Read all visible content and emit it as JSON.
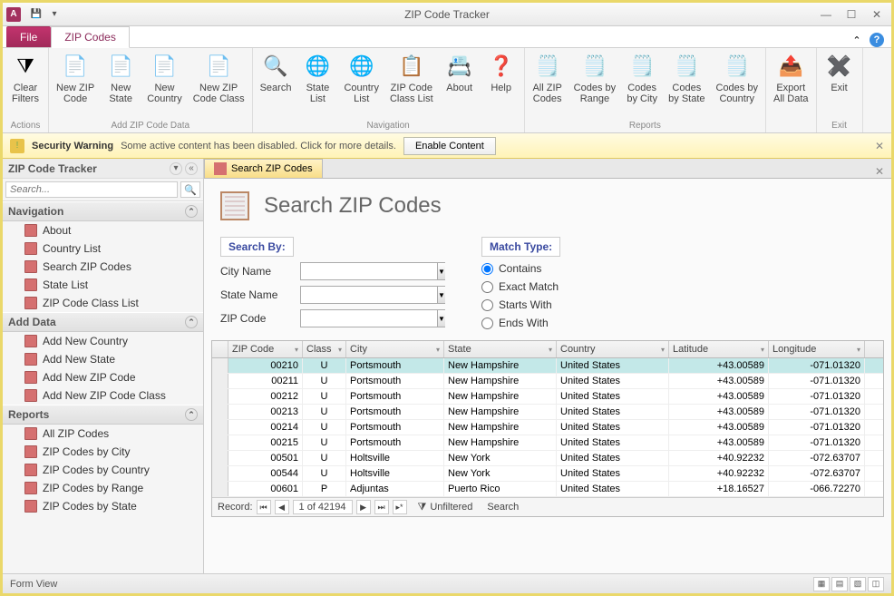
{
  "window": {
    "title": "ZIP Code Tracker"
  },
  "ribbon": {
    "file_tab": "File",
    "active_tab": "ZIP Codes",
    "groups": {
      "actions": {
        "label": "Actions",
        "clear_filters": "Clear\nFilters"
      },
      "add": {
        "label": "Add ZIP Code Data",
        "new_zip": "New ZIP\nCode",
        "new_state": "New\nState",
        "new_country": "New\nCountry",
        "new_class": "New ZIP\nCode Class"
      },
      "nav": {
        "label": "Navigation",
        "search": "Search",
        "state_list": "State\nList",
        "country_list": "Country\nList",
        "class_list": "ZIP Code\nClass List",
        "about": "About",
        "help": "Help"
      },
      "reports": {
        "label": "Reports",
        "all": "All ZIP\nCodes",
        "by_range": "Codes by\nRange",
        "by_city": "Codes\nby City",
        "by_state": "Codes\nby State",
        "by_country": "Codes by\nCountry"
      },
      "export": {
        "label": "",
        "export_all": "Export\nAll Data"
      },
      "exit": {
        "label": "Exit",
        "exit": "Exit"
      }
    }
  },
  "security": {
    "title": "Security Warning",
    "msg": "Some active content has been disabled. Click for more details.",
    "enable": "Enable Content"
  },
  "navpane": {
    "title": "ZIP Code Tracker",
    "search_placeholder": "Search...",
    "groups": [
      {
        "label": "Navigation",
        "items": [
          "About",
          "Country List",
          "Search ZIP Codes",
          "State List",
          "ZIP Code Class List"
        ]
      },
      {
        "label": "Add Data",
        "items": [
          "Add New Country",
          "Add New State",
          "Add New ZIP Code",
          "Add New ZIP Code Class"
        ]
      },
      {
        "label": "Reports",
        "items": [
          "All ZIP Codes",
          "ZIP Codes by City",
          "ZIP Codes by Country",
          "ZIP Codes by Range",
          "ZIP Codes by State"
        ]
      }
    ]
  },
  "doctab": {
    "label": "Search ZIP Codes"
  },
  "form": {
    "title": "Search ZIP Codes",
    "search_by": "Search By:",
    "city_name": "City Name",
    "state_name": "State Name",
    "zip_code": "ZIP Code",
    "match_type": "Match Type:",
    "contains": "Contains",
    "exact": "Exact Match",
    "starts": "Starts With",
    "ends": "Ends With"
  },
  "grid": {
    "columns": [
      "ZIP Code",
      "Class",
      "City",
      "State",
      "Country",
      "Latitude",
      "Longitude"
    ],
    "rows": [
      [
        "00210",
        "U",
        "Portsmouth",
        "New Hampshire",
        "United States",
        "+43.00589",
        "-071.01320"
      ],
      [
        "00211",
        "U",
        "Portsmouth",
        "New Hampshire",
        "United States",
        "+43.00589",
        "-071.01320"
      ],
      [
        "00212",
        "U",
        "Portsmouth",
        "New Hampshire",
        "United States",
        "+43.00589",
        "-071.01320"
      ],
      [
        "00213",
        "U",
        "Portsmouth",
        "New Hampshire",
        "United States",
        "+43.00589",
        "-071.01320"
      ],
      [
        "00214",
        "U",
        "Portsmouth",
        "New Hampshire",
        "United States",
        "+43.00589",
        "-071.01320"
      ],
      [
        "00215",
        "U",
        "Portsmouth",
        "New Hampshire",
        "United States",
        "+43.00589",
        "-071.01320"
      ],
      [
        "00501",
        "U",
        "Holtsville",
        "New York",
        "United States",
        "+40.92232",
        "-072.63707"
      ],
      [
        "00544",
        "U",
        "Holtsville",
        "New York",
        "United States",
        "+40.92232",
        "-072.63707"
      ],
      [
        "00601",
        "P",
        "Adjuntas",
        "Puerto Rico",
        "United States",
        "+18.16527",
        "-066.72270"
      ]
    ]
  },
  "recordnav": {
    "label": "Record:",
    "pos": "1 of 42194",
    "unfiltered": "Unfiltered",
    "search": "Search"
  },
  "status": {
    "view": "Form View"
  }
}
